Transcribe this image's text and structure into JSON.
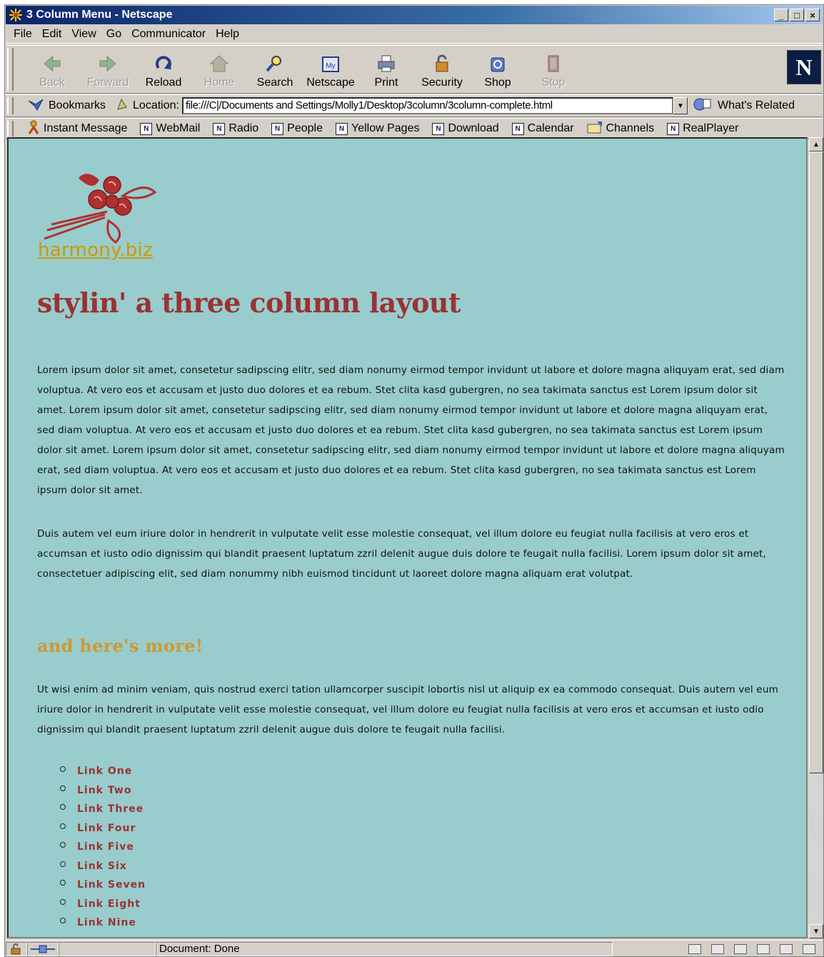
{
  "window": {
    "title": "3 Column Menu - Netscape"
  },
  "menu": [
    "File",
    "Edit",
    "View",
    "Go",
    "Communicator",
    "Help"
  ],
  "nav": [
    {
      "label": "Back",
      "icon": "back-arrow-icon",
      "enabled": false
    },
    {
      "label": "Forward",
      "icon": "forward-arrow-icon",
      "enabled": false
    },
    {
      "label": "Reload",
      "icon": "reload-icon",
      "enabled": true
    },
    {
      "label": "Home",
      "icon": "home-icon",
      "enabled": false
    },
    {
      "label": "Search",
      "icon": "search-icon",
      "enabled": true
    },
    {
      "label": "Netscape",
      "icon": "netscape-icon",
      "enabled": true
    },
    {
      "label": "Print",
      "icon": "print-icon",
      "enabled": true
    },
    {
      "label": "Security",
      "icon": "security-lock-icon",
      "enabled": true
    },
    {
      "label": "Shop",
      "icon": "shop-icon",
      "enabled": true
    },
    {
      "label": "Stop",
      "icon": "stop-icon",
      "enabled": false
    }
  ],
  "location": {
    "bookmarks_label": "Bookmarks",
    "location_label": "Location:",
    "url": "file:///C|/Documents and Settings/Molly1/Desktop/3column/3column-complete.html",
    "related_label": "What's Related"
  },
  "personal": [
    "Instant Message",
    "WebMail",
    "Radio",
    "People",
    "Yellow Pages",
    "Download",
    "Calendar",
    "Channels",
    "RealPlayer"
  ],
  "page": {
    "logo_text": "harmony.biz",
    "heading": "stylin' a three column layout",
    "para1": "Lorem ipsum dolor sit amet, consetetur sadipscing elitr, sed diam nonumy eirmod tempor invidunt ut labore et dolore magna aliquyam erat, sed diam voluptua. At vero eos et accusam et justo duo dolores et ea rebum. Stet clita kasd gubergren, no sea takimata sanctus est Lorem ipsum dolor sit amet. Lorem ipsum dolor sit amet, consetetur sadipscing elitr, sed diam nonumy eirmod tempor invidunt ut labore et dolore magna aliquyam erat, sed diam voluptua. At vero eos et accusam et justo duo dolores et ea rebum. Stet clita kasd gubergren, no sea takimata sanctus est Lorem ipsum dolor sit amet. Lorem ipsum dolor sit amet, consetetur sadipscing elitr, sed diam nonumy eirmod tempor invidunt ut labore et dolore magna aliquyam erat, sed diam voluptua. At vero eos et accusam et justo duo dolores et ea rebum. Stet clita kasd gubergren, no sea takimata sanctus est Lorem ipsum dolor sit amet.",
    "para2": "Duis autem vel eum iriure dolor in hendrerit in vulputate velit esse molestie consequat, vel illum dolore eu feugiat nulla facilisis at vero eros et accumsan et iusto odio dignissim qui blandit praesent luptatum zzril delenit augue duis dolore te feugait nulla facilisi. Lorem ipsum dolor sit amet, consectetuer adipiscing elit, sed diam nonummy nibh euismod tincidunt ut laoreet dolore magna aliquam erat volutpat.",
    "subheading": "and here's more!",
    "para3": "Ut wisi enim ad minim veniam, quis nostrud exerci tation ullamcorper suscipit lobortis nisl ut aliquip ex ea commodo consequat. Duis autem vel eum iriure dolor in hendrerit in vulputate velit esse molestie consequat, vel illum dolore eu feugiat nulla facilisis at vero eros et accumsan et iusto odio dignissim qui blandit praesent luptatum zzril delenit augue duis dolore te feugait nulla facilisi.",
    "links": [
      "Link One",
      "Link Two",
      "Link Three",
      "Link Four",
      "Link Five",
      "Link Six",
      "Link Seven",
      "Link Eight",
      "Link Nine"
    ]
  },
  "status": {
    "text": "Document: Done"
  },
  "colors": {
    "page_bg": "#99cccc",
    "heading": "#993333",
    "subheading": "#cc9933",
    "logo": "#cc9900",
    "link": "#993333"
  }
}
